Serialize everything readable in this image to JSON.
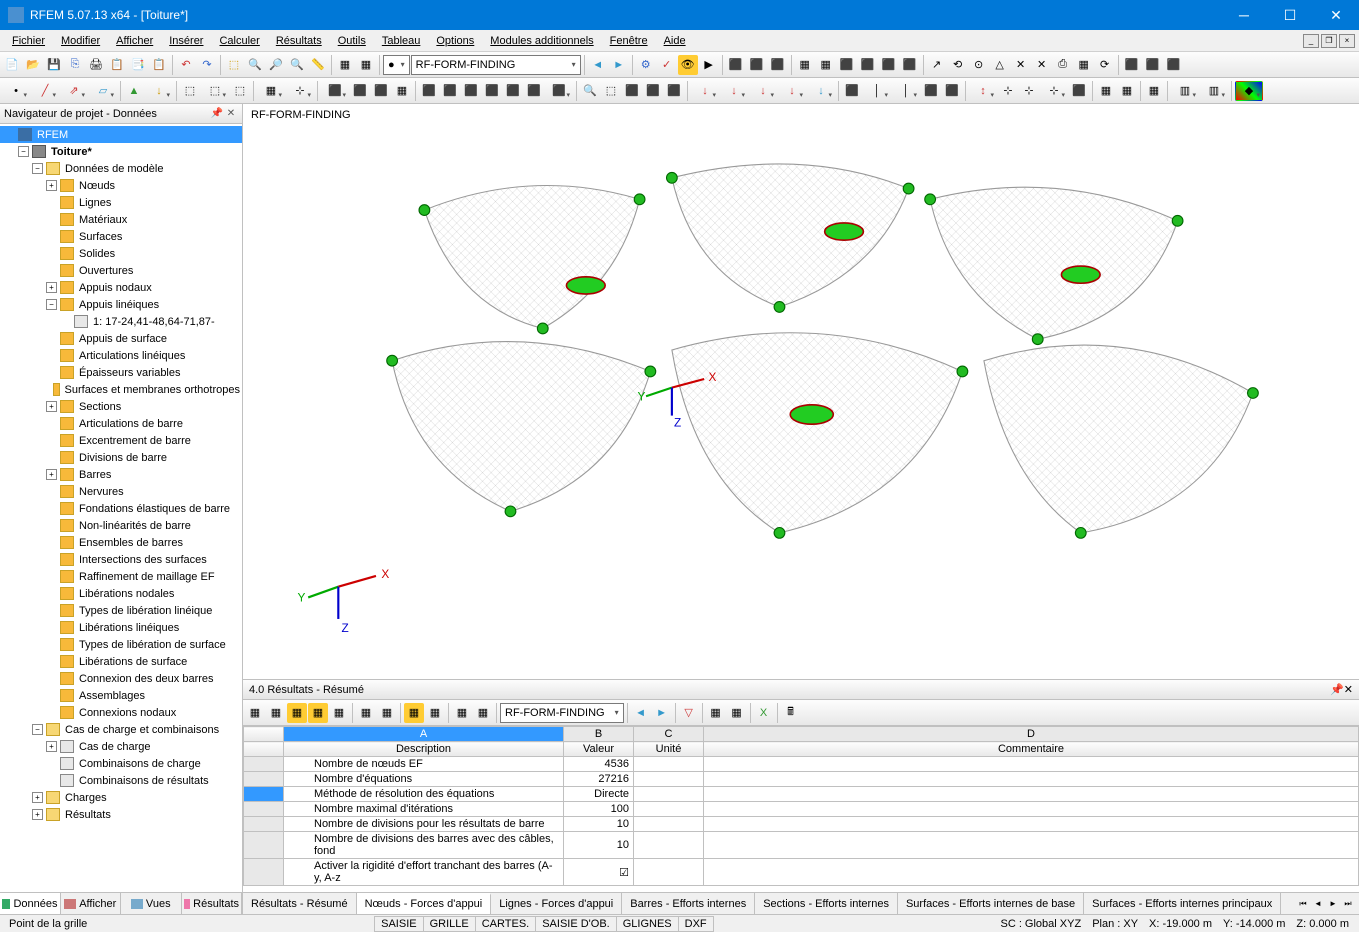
{
  "app": {
    "title": "RFEM 5.07.13 x64 - [Toiture*]"
  },
  "menu": [
    "Fichier",
    "Modifier",
    "Afficher",
    "Insérer",
    "Calculer",
    "Résultats",
    "Outils",
    "Tableau",
    "Options",
    "Modules additionnels",
    "Fenêtre",
    "Aide"
  ],
  "toolbar1_combo": "RF-FORM-FINDING",
  "sidebar": {
    "title": "Navigateur de projet - Données",
    "root": "RFEM",
    "model": "Toiture*",
    "groups": {
      "model_data": "Données de modèle",
      "load_cases": "Cas de charge et combinaisons",
      "loads": "Charges",
      "results": "Résultats"
    },
    "model_items": [
      {
        "t": "Nœuds",
        "exp": true
      },
      {
        "t": "Lignes",
        "exp": false
      },
      {
        "t": "Matériaux",
        "exp": false
      },
      {
        "t": "Surfaces",
        "exp": false
      },
      {
        "t": "Solides",
        "exp": false
      },
      {
        "t": "Ouvertures",
        "exp": false
      },
      {
        "t": "Appuis nodaux",
        "exp": true
      },
      {
        "t": "Appuis linéiques",
        "exp": true,
        "open": true,
        "child": "1: 17-24,41-48,64-71,87-"
      },
      {
        "t": "Appuis de surface",
        "exp": false
      },
      {
        "t": "Articulations linéiques",
        "exp": false
      },
      {
        "t": "Épaisseurs variables",
        "exp": false
      },
      {
        "t": "Surfaces et membranes orthotropes",
        "exp": false
      },
      {
        "t": "Sections",
        "exp": true
      },
      {
        "t": "Articulations de barre",
        "exp": false
      },
      {
        "t": "Excentrement de barre",
        "exp": false
      },
      {
        "t": "Divisions de barre",
        "exp": false
      },
      {
        "t": "Barres",
        "exp": true
      },
      {
        "t": "Nervures",
        "exp": false
      },
      {
        "t": "Fondations élastiques de barre",
        "exp": false
      },
      {
        "t": "Non-linéarités de barre",
        "exp": false
      },
      {
        "t": "Ensembles de barres",
        "exp": false
      },
      {
        "t": "Intersections des surfaces",
        "exp": false
      },
      {
        "t": "Raffinement de maillage EF",
        "exp": false
      },
      {
        "t": "Libérations nodales",
        "exp": false
      },
      {
        "t": "Types de libération linéique",
        "exp": false
      },
      {
        "t": "Libérations linéiques",
        "exp": false
      },
      {
        "t": "Types de libération de surface",
        "exp": false
      },
      {
        "t": "Libérations de surface",
        "exp": false
      },
      {
        "t": "Connexion des deux barres",
        "exp": false
      },
      {
        "t": "Assemblages",
        "exp": false
      },
      {
        "t": "Connexions nodaux",
        "exp": false
      }
    ],
    "lc_items": [
      "Cas de charge",
      "Combinaisons de charge",
      "Combinaisons de résultats"
    ],
    "tabs": [
      "Données",
      "Afficher",
      "Vues",
      "Résultats"
    ]
  },
  "viewport": {
    "label": "RF-FORM-FINDING"
  },
  "results_panel": {
    "title": "4.0 Résultats - Résumé",
    "combo": "RF-FORM-FINDING",
    "col_letters": [
      "A",
      "B",
      "C",
      "D"
    ],
    "cols": [
      "Description",
      "Valeur",
      "Unité",
      "Commentaire"
    ],
    "rows": [
      {
        "desc": "Nombre de nœuds EF",
        "val": "4536",
        "unit": "",
        "com": ""
      },
      {
        "desc": "Nombre d'équations",
        "val": "27216",
        "unit": "",
        "com": ""
      },
      {
        "desc": "Méthode de résolution des équations",
        "val": "Directe",
        "unit": "",
        "com": "",
        "sel": true
      },
      {
        "desc": "Nombre maximal d'itérations",
        "val": "100",
        "unit": "",
        "com": ""
      },
      {
        "desc": "Nombre de divisions pour les résultats de barre",
        "val": "10",
        "unit": "",
        "com": ""
      },
      {
        "desc": "Nombre de divisions des barres avec des câbles, fond",
        "val": "10",
        "unit": "",
        "com": ""
      },
      {
        "desc": "Activer la rigidité d'effort tranchant des barres (A-y, A-z",
        "val": "☑",
        "unit": "",
        "com": ""
      }
    ],
    "tabs": [
      "Résultats - Résumé",
      "Nœuds - Forces d'appui",
      "Lignes - Forces d'appui",
      "Barres - Efforts internes",
      "Sections - Efforts internes",
      "Surfaces - Efforts internes de base",
      "Surfaces - Efforts internes principaux"
    ]
  },
  "statusbar": {
    "left": "Point de la grille",
    "toggles": [
      "SAISIE",
      "GRILLE",
      "CARTES.",
      "SAISIE D'OB.",
      "GLIGNES",
      "DXF"
    ],
    "sc": "SC : Global XYZ",
    "plan": "Plan : XY",
    "x": "X: -19.000 m",
    "y": "Y: -14.000 m",
    "z": "Z:  0.000 m"
  }
}
